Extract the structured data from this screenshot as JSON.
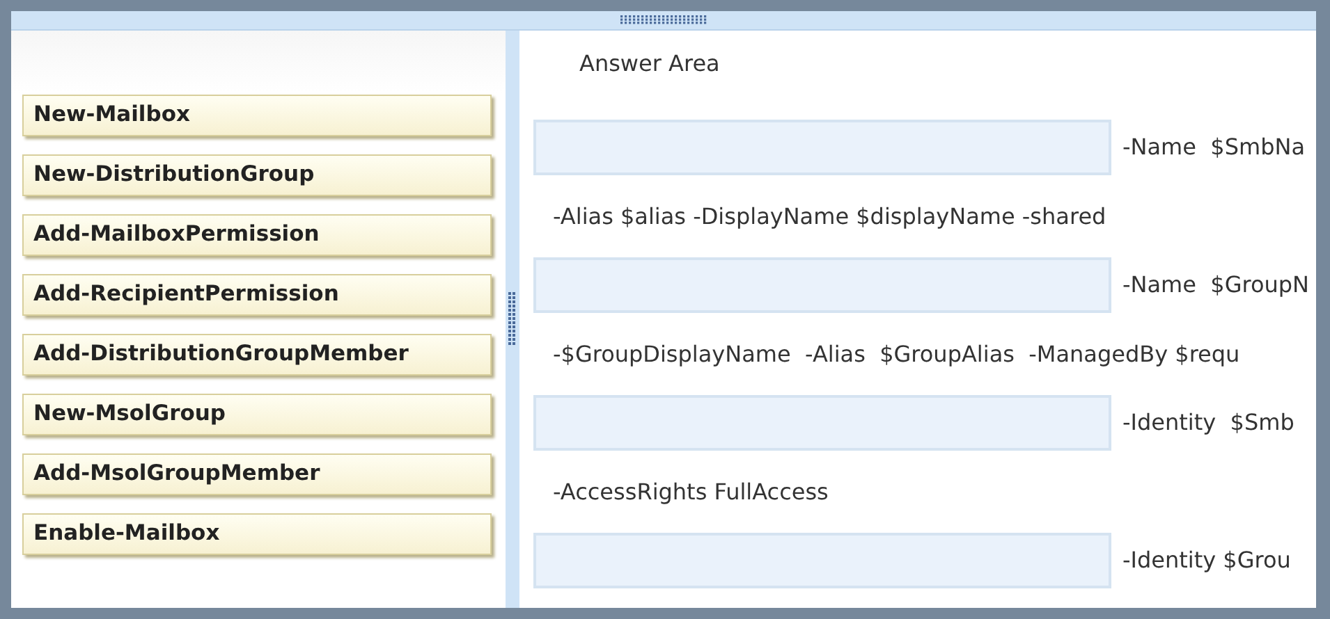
{
  "commands": [
    {
      "label": "New-Mailbox"
    },
    {
      "label": "New-DistributionGroup"
    },
    {
      "label": "Add-MailboxPermission"
    },
    {
      "label": "Add-RecipientPermission"
    },
    {
      "label": "Add-DistributionGroupMember"
    },
    {
      "label": "New-MsolGroup"
    },
    {
      "label": "Add-MsolGroupMember"
    },
    {
      "label": "Enable-Mailbox"
    }
  ],
  "answer_area": {
    "title": "Answer Area",
    "rows": [
      {
        "kind": "slot",
        "text": "-Name  $SmbNa"
      },
      {
        "kind": "line",
        "text": "-Alias $alias -DisplayName $displayName -shared"
      },
      {
        "kind": "slot",
        "text": "-Name  $GroupN"
      },
      {
        "kind": "line",
        "text": "-$GroupDisplayName  -Alias  $GroupAlias  -ManagedBy $requ"
      },
      {
        "kind": "slot",
        "text": "-Identity  $Smb"
      },
      {
        "kind": "line",
        "text": "-AccessRights FullAccess"
      },
      {
        "kind": "slot",
        "text": "-Identity $Grou"
      }
    ]
  }
}
